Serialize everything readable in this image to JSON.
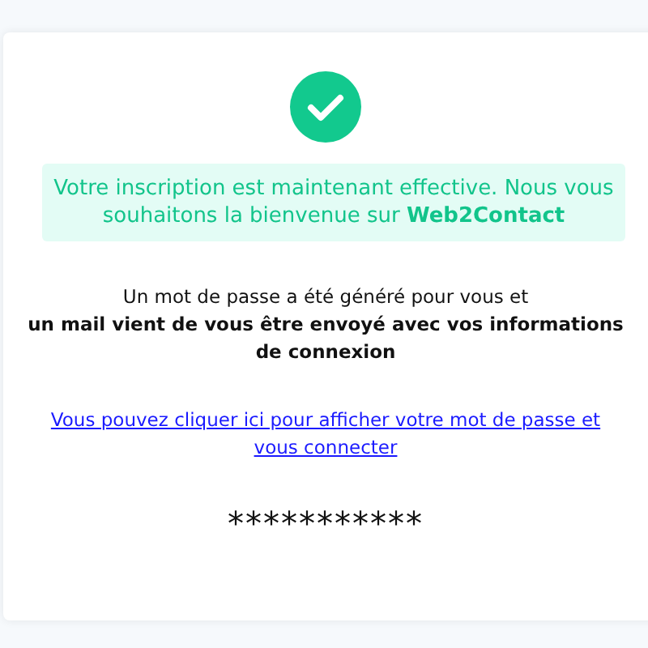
{
  "success_message": "Votre inscription est maintenant effective. Nous vous souhaitons la bienvenue sur **Web2Contact**",
  "info_text": "Un mot de passe a été généré pour vous et\n**un mail vient de vous être envoyé avec vos informations de connexion**",
  "link": "Vous pouvez cliquer ici pour afficher votre mot de passe et vous connecter",
  "password": "***********"
}
